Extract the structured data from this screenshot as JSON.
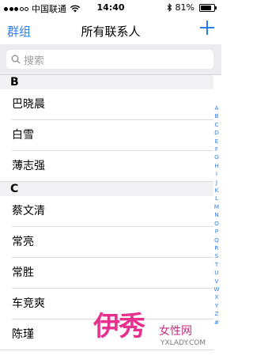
{
  "status_bar": {
    "carrier": "中国联通",
    "time": "14:40",
    "battery_percent_label": "81%",
    "battery_level": 0.81
  },
  "nav": {
    "left_label": "群组",
    "title": "所有联系人",
    "add_label": "+"
  },
  "search": {
    "placeholder": "搜索"
  },
  "sections": [
    {
      "letter": "B",
      "contacts": [
        "巴晓晨",
        "白雪",
        "薄志强"
      ]
    },
    {
      "letter": "C",
      "contacts": [
        "蔡文清",
        "常亮",
        "常胜",
        "车竞爽",
        "陈瑾"
      ]
    }
  ],
  "index_letters": [
    "A",
    "B",
    "C",
    "D",
    "E",
    "F",
    "G",
    "H",
    "I",
    "J",
    "K",
    "L",
    "M",
    "N",
    "O",
    "P",
    "Q",
    "R",
    "S",
    "T",
    "U",
    "V",
    "W",
    "X",
    "Y",
    "Z",
    "#"
  ],
  "watermark": {
    "logo": "伊秀",
    "text": "女性网",
    "url": "YXLADY.COM"
  },
  "colors": {
    "accent": "#2a7ef4",
    "section_bg": "#f2f2f4",
    "watermark": "#e8308f"
  }
}
